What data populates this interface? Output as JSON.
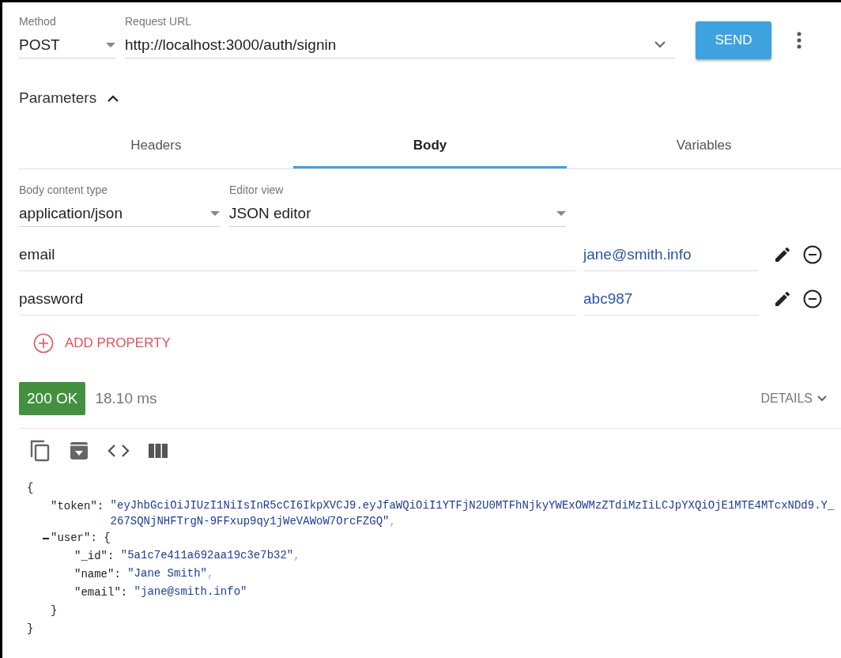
{
  "request": {
    "method_label": "Method",
    "method": "POST",
    "url_label": "Request URL",
    "url": "http://localhost:3000/auth/signin",
    "send": "SEND"
  },
  "parameters": {
    "title": "Parameters",
    "expanded": true
  },
  "tabs": [
    {
      "label": "Headers",
      "selected": false
    },
    {
      "label": "Body",
      "selected": true
    },
    {
      "label": "Variables",
      "selected": false
    }
  ],
  "body": {
    "content_type_label": "Body content type",
    "content_type": "application/json",
    "editor_view_label": "Editor view",
    "editor_view": "JSON editor"
  },
  "properties": [
    {
      "name": "email",
      "value": "jane@smith.info"
    },
    {
      "name": "password",
      "value": "abc987"
    }
  ],
  "add_property": "ADD PROPERTY",
  "response": {
    "status": "200 OK",
    "time": "18.10 ms",
    "details": "DETAILS",
    "json": {
      "open": "{",
      "close": "}",
      "entries": [
        {
          "key": "\"token\":",
          "value": "\"eyJhbGciOiJIUzI1NiIsInR5cCI6IkpXVCJ9.eyJfaWQiOiI1YTFjN2U0MTFhNjkyYWExOWMzZTdiMzIiLCJpYXQiOjE1MTE4MTcxNDd9.Y_267SQNjNHFTrgN-9FFxup9qy1jWeVAWoW7OrcFZGQ\"",
          "comma": ","
        },
        {
          "key": "\"user\":",
          "open": "{",
          "close": "}",
          "expanded": true,
          "entries": [
            {
              "key": "\"_id\":",
              "value": "\"5a1c7e411a692aa19c3e7b32\"",
              "comma": ","
            },
            {
              "key": "\"name\":",
              "value": "\"Jane Smith\"",
              "comma": ","
            },
            {
              "key": "\"email\":",
              "value": "\"jane@smith.info\""
            }
          ]
        }
      ]
    }
  }
}
